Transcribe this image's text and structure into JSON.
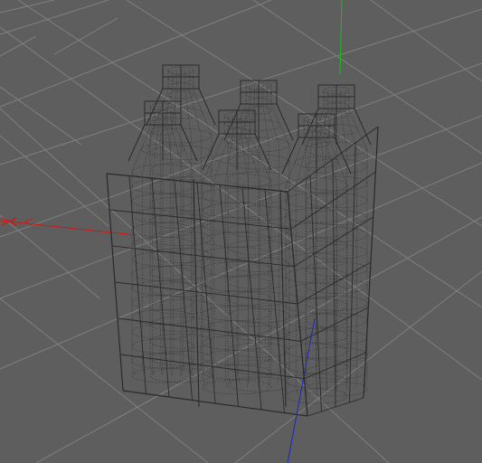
{
  "viewport": {
    "view": "perspective-3d-viewport",
    "background": "#5e5e5e",
    "grid_color": "#808080",
    "cage_color": "#2a2a2a",
    "bottle_color": "#3a3a3a",
    "axes": {
      "x": {
        "color": "#d01818"
      },
      "y": {
        "color": "#18c018"
      },
      "z": {
        "color": "#2020d0"
      }
    },
    "object": {
      "type": "wireframe-mesh",
      "description_icon": "bottle-pack-6-mesh",
      "bottle_count": 6,
      "layout": "3x2"
    }
  }
}
